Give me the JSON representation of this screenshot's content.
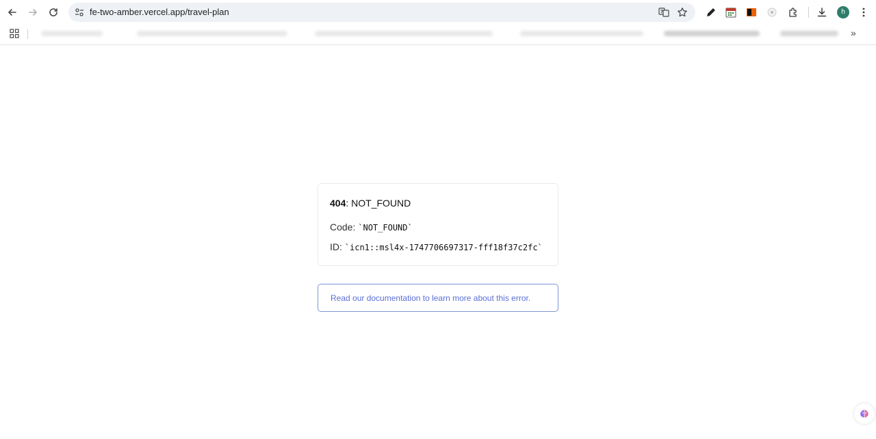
{
  "browser": {
    "url": "fe-two-amber.vercel.app/travel-plan",
    "avatar_letter": "h",
    "bookmarks_more": "»",
    "colors": {
      "omnibox_bg": "#eef1f5",
      "avatar_bg": "#2e7d6b"
    }
  },
  "error": {
    "status_code": "404",
    "status_text": ": NOT_FOUND",
    "code_label": "Code: ",
    "code_value": "`NOT_FOUND`",
    "id_label": "ID: ",
    "id_value": "`icn1::msl4x-1747706697317-fff18f37c2fc`",
    "doc_link_text": "Read our documentation to learn more about this error.",
    "colors": {
      "link": "#5a6fd6",
      "link_border": "#7f95d6"
    }
  }
}
